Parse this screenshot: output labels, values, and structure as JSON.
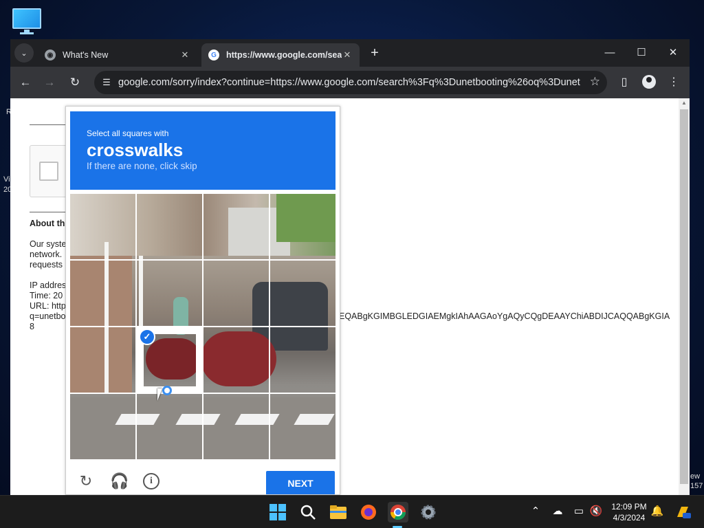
{
  "desktop": {
    "edge_left_1": "R",
    "edge_left_2": "Vi",
    "edge_left_3": "20",
    "edge_right_1": "ew",
    "edge_right_2": "157"
  },
  "browser": {
    "tabs": [
      {
        "title": "What's New",
        "active": false
      },
      {
        "title": "https://www.google.com/sear",
        "active": true
      }
    ],
    "new_tab_label": "+",
    "address": "google.com/sorry/index?continue=https://www.google.com/search%3Fq%3Dunetbooting%26oq%3Dunet..."
  },
  "sorry_page": {
    "about_heading": "About th",
    "para_line1": "Our syste",
    "para_line2": "network.",
    "para_line3": "requests",
    "ip_line": "IP addres",
    "time_line": "Time: 20",
    "url_line": "URL: http",
    "q_line": "q=unetbo",
    "eight_line": "8",
    "long_code": "EQABgKGIMBGLEDGIAEMgkIAhAAGAoYgAQyCQgDEAAYChiABDIJCAQQABgKGIA"
  },
  "captcha": {
    "instruction": "Select all squares with",
    "target": "crosswalks",
    "hint": "If there are none, click skip",
    "next_label": "NEXT",
    "selected_tiles": [
      9
    ],
    "grid_size": 4
  },
  "taskbar": {
    "time": "12:09 PM",
    "date": "4/3/2024"
  }
}
